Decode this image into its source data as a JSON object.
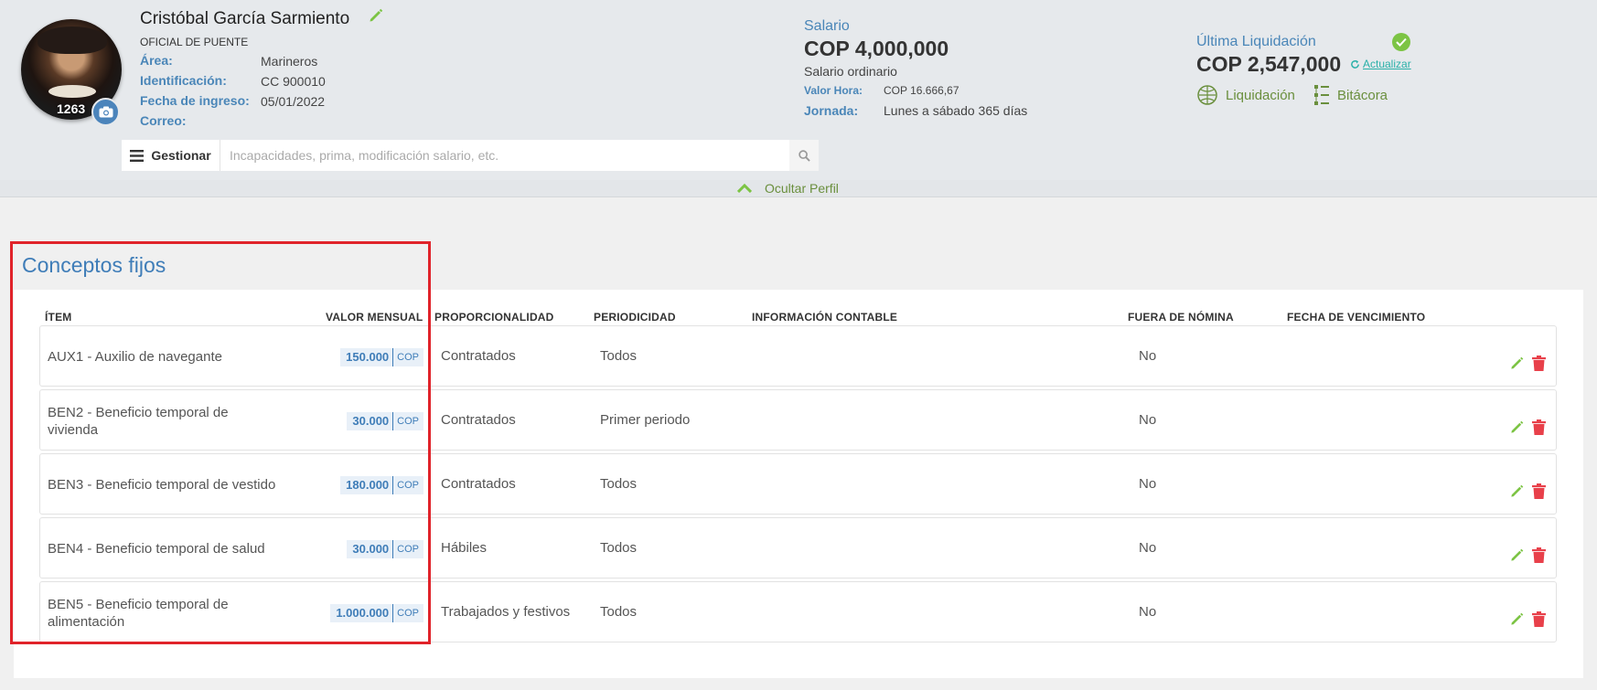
{
  "employee": {
    "name": "Cristóbal García Sarmiento",
    "position": "OFICIAL DE PUENTE",
    "number": "1263",
    "fields": [
      {
        "label": "Área:",
        "value": "Marineros"
      },
      {
        "label": "Identificación:",
        "value": "CC 900010"
      },
      {
        "label": "Fecha de ingreso:",
        "value": "05/01/2022"
      },
      {
        "label": "Correo:",
        "value": ""
      }
    ]
  },
  "salary": {
    "title": "Salario",
    "amount": "COP 4,000,000",
    "type": "Salario ordinario",
    "valor_hora_label": "Valor Hora:",
    "valor_hora_value": "COP 16.666,67",
    "jornada_label": "Jornada:",
    "jornada_value": "Lunes a sábado 365 días"
  },
  "last_settlement": {
    "title": "Última Liquidación",
    "amount": "COP 2,547,000",
    "refresh_label": "Actualizar",
    "liquidacion_label": "Liquidación",
    "bitacora_label": "Bitácora"
  },
  "search": {
    "manage_label": "Gestionar",
    "placeholder": "Incapacidades, prima, modificación salario, etc."
  },
  "toggle_profile_label": "Ocultar Perfil",
  "section": {
    "title": "Conceptos fijos",
    "columns": {
      "item": "ÍTEM",
      "valor_mensual": "VALOR MENSUAL",
      "proporcionalidad": "PROPORCIONALIDAD",
      "periodicidad": "PERIODICIDAD",
      "informacion_contable": "INFORMACIÓN CONTABLE",
      "fuera_nomina": "FUERA DE NÓMINA",
      "fecha_vencimiento": "FECHA DE VENCIMIENTO"
    },
    "rows": [
      {
        "item": "AUX1 - Auxilio de navegante",
        "value": "150.000",
        "currency": "COP",
        "prop": "Contratados",
        "period": "Todos",
        "fuera": "No"
      },
      {
        "item": "BEN2 - Beneficio temporal de vivienda",
        "value": "30.000",
        "currency": "COP",
        "prop": "Contratados",
        "period": "Primer periodo",
        "fuera": "No"
      },
      {
        "item": "BEN3 - Beneficio temporal de vestido",
        "value": "180.000",
        "currency": "COP",
        "prop": "Contratados",
        "period": "Todos",
        "fuera": "No"
      },
      {
        "item": "BEN4 - Beneficio temporal de salud",
        "value": "30.000",
        "currency": "COP",
        "prop": "Hábiles",
        "period": "Todos",
        "fuera": "No"
      },
      {
        "item": "BEN5 - Beneficio temporal de alimentación",
        "value": "1.000.000",
        "currency": "COP",
        "prop": "Trabajados y festivos",
        "period": "Todos",
        "fuera": "No"
      }
    ]
  },
  "colors": {
    "accent_blue": "#3f7db8",
    "link_green": "#6a8f3d",
    "edit_green": "#7cc444",
    "delete_red": "#e8404a",
    "highlight_red": "#e0232a"
  }
}
